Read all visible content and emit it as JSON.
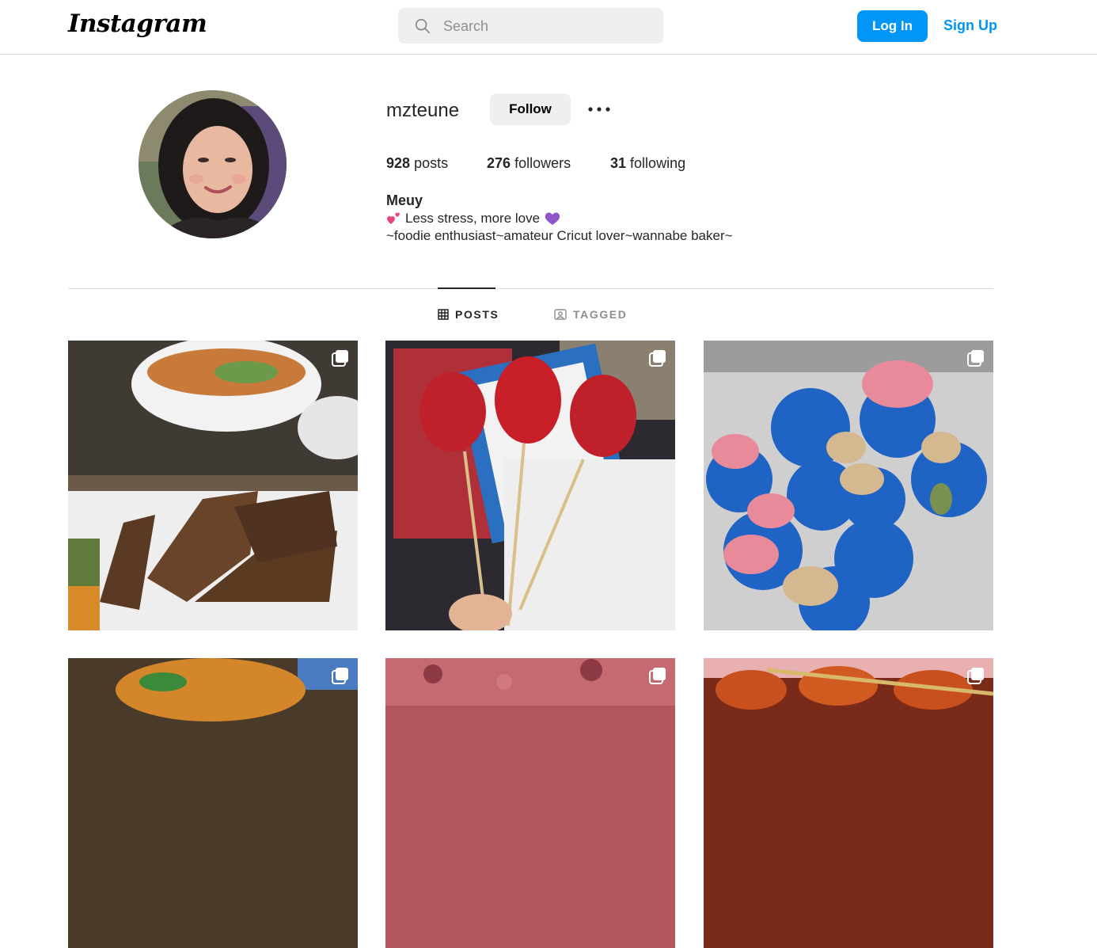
{
  "topbar": {
    "logo_text": "Instagram",
    "search_placeholder": "Search",
    "login_label": "Log In",
    "signup_label": "Sign Up",
    "accent_color": "#0095f6"
  },
  "profile": {
    "username": "mzteune",
    "follow_label": "Follow",
    "posts_count": "928",
    "posts_label": "posts",
    "followers_count": "276",
    "followers_label": "followers",
    "following_count": "31",
    "following_label": "following",
    "full_name": "Meuy",
    "bio_line1": "Less stress, more love",
    "bio_line2": "~foodie enthusiast~amateur Cricut lover~wannabe baker~",
    "bio_line1_emoji_start": "two-hearts",
    "bio_line1_emoji_end": "purple-heart"
  },
  "tabs": [
    {
      "label": "POSTS",
      "icon": "grid-icon",
      "active": true
    },
    {
      "label": "TAGGED",
      "icon": "tag-user-icon",
      "active": false
    }
  ],
  "posts": [
    {
      "subject": "grilled ribs with soup",
      "multi": true
    },
    {
      "subject": "candied strawberries on skewers",
      "multi": true
    },
    {
      "subject": "blue glazed pastries",
      "multi": true
    },
    {
      "subject": "stir fry dish",
      "multi": true
    },
    {
      "subject": "minced meat",
      "multi": true
    },
    {
      "subject": "glazed skewers",
      "multi": true
    }
  ]
}
